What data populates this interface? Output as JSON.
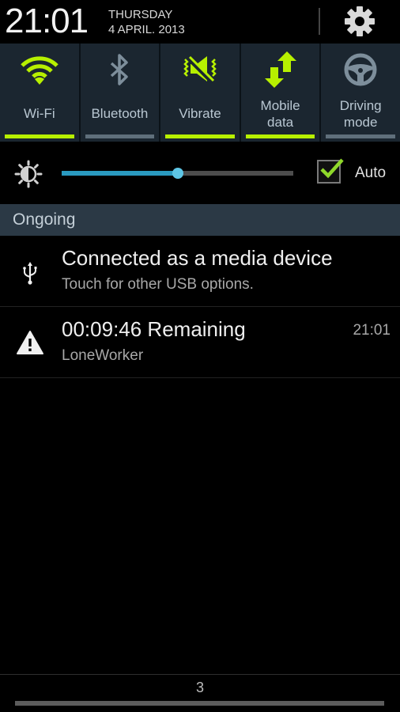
{
  "header": {
    "time": "21:01",
    "day": "THURSDAY",
    "date": "4 APRIL. 2013",
    "settings_icon": "gear-icon"
  },
  "quick_settings": {
    "active_color": "#b7f000",
    "inactive_color": "#5f6f7b",
    "tiles": [
      {
        "label": "Wi-Fi",
        "icon": "wifi-icon",
        "active": true
      },
      {
        "label": "Bluetooth",
        "icon": "bluetooth-icon",
        "active": false
      },
      {
        "label": "Vibrate",
        "icon": "vibrate-icon",
        "active": true
      },
      {
        "label_line1": "Mobile",
        "label_line2": "data",
        "icon": "mobile-data-icon",
        "active": true
      },
      {
        "label_line1": "Driving",
        "label_line2": "mode",
        "icon": "steering-wheel-icon",
        "active": false
      }
    ]
  },
  "brightness": {
    "icon": "brightness-icon",
    "level": 0.5,
    "auto_checked": true,
    "auto_label": "Auto"
  },
  "section": {
    "title": "Ongoing"
  },
  "notifications": [
    {
      "icon": "usb-icon",
      "title": "Connected as a media device",
      "subtitle": "Touch for other USB options.",
      "time": ""
    },
    {
      "icon": "warning-icon",
      "title": "00:09:46 Remaining",
      "subtitle": "LoneWorker",
      "time": "21:01"
    }
  ],
  "footer": {
    "count": "3"
  }
}
